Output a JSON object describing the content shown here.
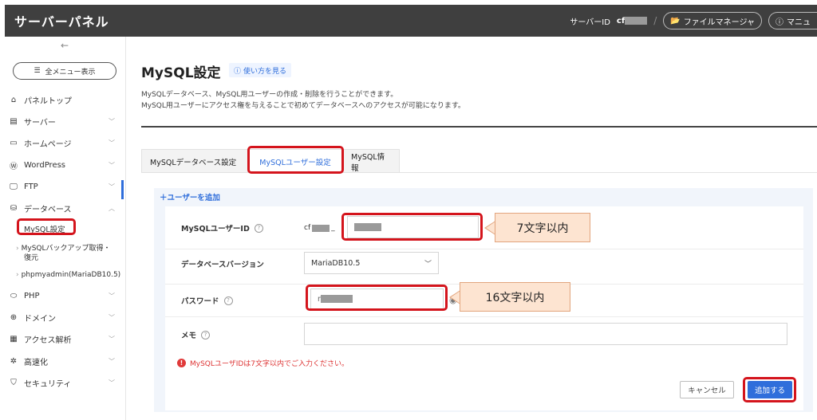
{
  "header": {
    "title": "サーバーパネル",
    "server_label": "サーバーID",
    "server_id_prefix": "cf",
    "file_manager": "ファイルマネージャ",
    "manual": "マニュ"
  },
  "sidebar": {
    "collapse_arrow": "←",
    "all_menu": "全メニュー表示",
    "items": [
      {
        "label": "パネルトップ",
        "icon": "home-icon"
      },
      {
        "label": "サーバー",
        "icon": "server-icon"
      },
      {
        "label": "ホームページ",
        "icon": "window-icon"
      },
      {
        "label": "WordPress",
        "icon": "wordpress-icon"
      },
      {
        "label": "FTP",
        "icon": "monitor-icon"
      },
      {
        "label": "データベース",
        "icon": "database-icon"
      },
      {
        "label": "PHP",
        "icon": "php-icon"
      },
      {
        "label": "ドメイン",
        "icon": "globe-icon"
      },
      {
        "label": "アクセス解析",
        "icon": "chart-icon"
      },
      {
        "label": "高速化",
        "icon": "speed-icon"
      },
      {
        "label": "セキュリティ",
        "icon": "shield-icon"
      }
    ],
    "sub_items": {
      "mysql_settings": "MySQL設定",
      "mysql_backup_line1": "MySQLバックアップ取得・",
      "mysql_backup_line2": "復元",
      "phpmyadmin": "phpmyadmin(MariaDB10.5)"
    }
  },
  "main": {
    "title": "MySQL設定",
    "howto": "使い方を見る",
    "desc_line1": "MySQLデータベース、MySQL用ユーザーの作成・削除を行うことができます。",
    "desc_line2": "MySQL用ユーザーにアクセス権を与えることで初めてデータベースへのアクセスが可能になります。",
    "tabs": [
      {
        "label": "MySQLデータベース設定"
      },
      {
        "label": "MySQLユーザー設定"
      },
      {
        "label": "MySQL情報"
      }
    ],
    "add_user": "ユーザーを追加",
    "form": {
      "user_id_label": "MySQLユーザーID",
      "user_id_prefix_start": "cf",
      "user_id_prefix_end": "_",
      "db_version_label": "データベースバージョン",
      "db_version_value": "MariaDB10.5",
      "password_label": "パスワード",
      "password_prefix": "r",
      "memo_label": "メモ",
      "error": "MySQLユーザIDは7文字以内でご入力ください。",
      "cancel": "キャンセル",
      "submit": "追加する"
    },
    "annotations": {
      "callout1": "7文字以内",
      "callout2": "16文字以内"
    }
  },
  "colors": {
    "header_bg": "#3f3f3f",
    "accent": "#2f6edb",
    "annotation_red": "#d4141c",
    "callout_bg": "#fde4d1",
    "error": "#e03a3a"
  }
}
